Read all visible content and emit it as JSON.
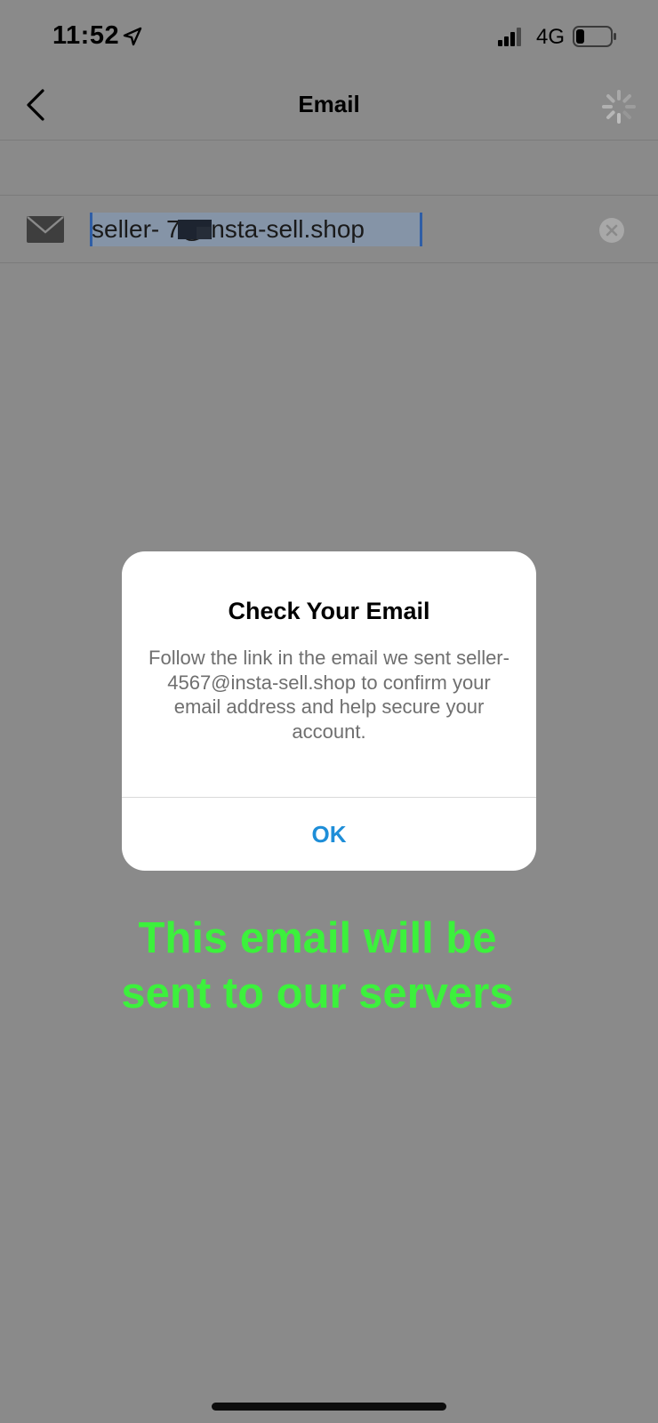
{
  "status_bar": {
    "time": "11:52",
    "network": "4G",
    "icons": [
      "location-arrow-icon",
      "signal-bars-icon",
      "battery-icon"
    ]
  },
  "nav": {
    "title": "Email",
    "back_icon": "chevron-left-icon",
    "loading_icon": "spinner-icon"
  },
  "email_field": {
    "value": "seller-      7@insta-sell.shop",
    "icon": "mail-icon",
    "clear_icon": "clear-circle-icon",
    "selected": true,
    "redacted": true
  },
  "dialog": {
    "title": "Check Your Email",
    "message": "Follow the link in the email we sent seller-4567@insta-sell.shop to confirm your email address and help secure your account.",
    "ok_label": "OK"
  },
  "annotation": {
    "line1": "This email will be",
    "line2": "sent to our servers"
  },
  "colors": {
    "backdrop": "#8a8a8a",
    "ok_blue": "#1e8ed8",
    "annotation_green": "#3cf13c",
    "selection": "#8594a7"
  }
}
